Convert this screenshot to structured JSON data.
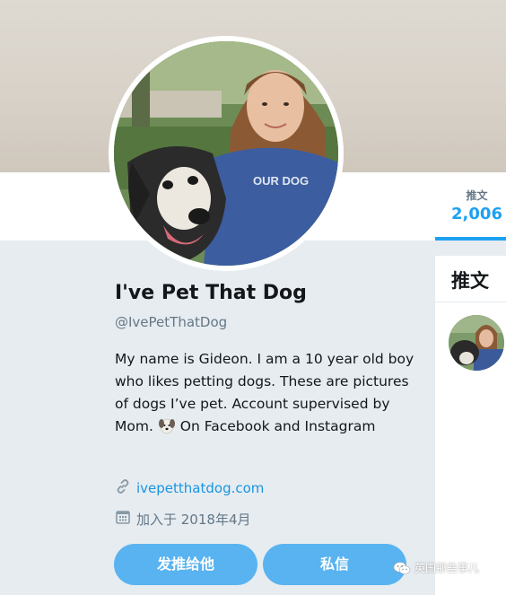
{
  "profile": {
    "display_name": "I've Pet That Dog",
    "handle": "@IvePetThatDog",
    "bio_part1": "My name is Gideon. I am a 10 year old boy who likes petting dogs. These are pictures of dogs I’ve pet. Account supervised by Mom.",
    "bio_part2": "On Facebook and Instagram",
    "website": "ivepetthatdog.com",
    "joined": "加入于 2018年4月"
  },
  "stats": {
    "tweets_label": "推文",
    "tweets_count": "2,006"
  },
  "tweets_panel": {
    "header": "推文"
  },
  "actions": {
    "follow_label": "发推给他",
    "message_label": "私信"
  },
  "watermark": {
    "text": "英国那些事儿"
  },
  "colors": {
    "accent": "#1da1f2",
    "button": "#58b3f0",
    "background": "#e6ecf0"
  },
  "icons": [
    "link-icon",
    "calendar-icon",
    "dog-face-emoji-icon",
    "wechat-icon"
  ]
}
